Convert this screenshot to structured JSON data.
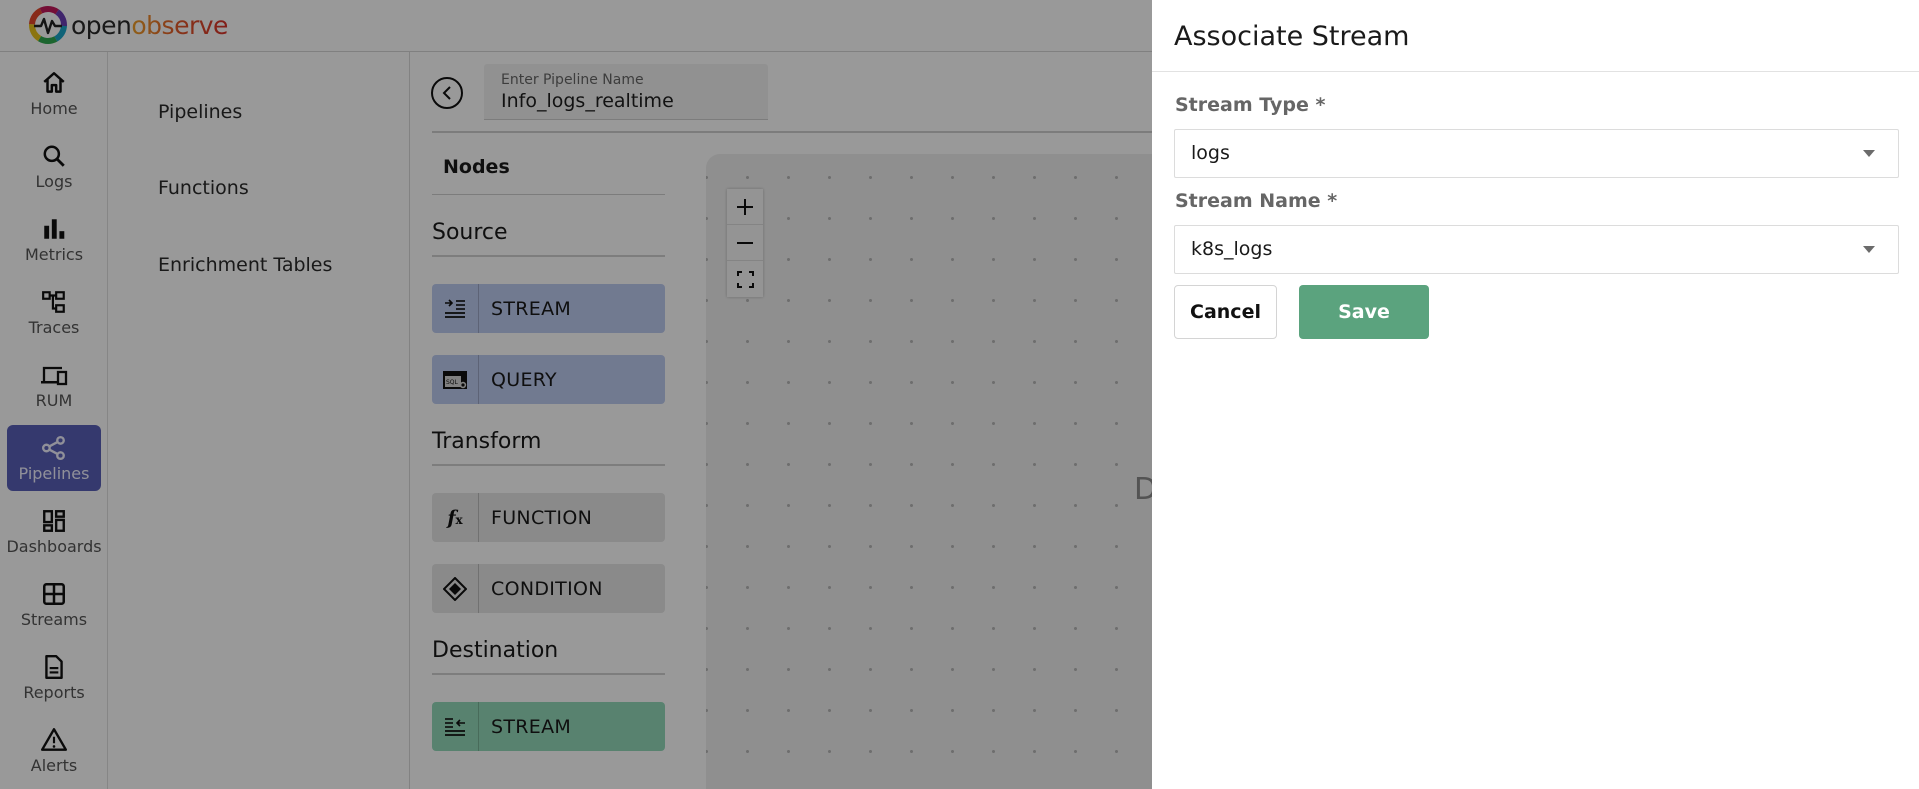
{
  "brand": {
    "name_part1": "open",
    "name_part2": "observe"
  },
  "leftnav": {
    "items": [
      {
        "label": "Home",
        "icon": "home-icon",
        "active": false
      },
      {
        "label": "Logs",
        "icon": "search-icon",
        "active": false
      },
      {
        "label": "Metrics",
        "icon": "bar-chart-icon",
        "active": false
      },
      {
        "label": "Traces",
        "icon": "traces-tree-icon",
        "active": false
      },
      {
        "label": "RUM",
        "icon": "devices-icon",
        "active": false
      },
      {
        "label": "Pipelines",
        "icon": "share-nodes-icon",
        "active": true
      },
      {
        "label": "Dashboards",
        "icon": "dashboard-icon",
        "active": false
      },
      {
        "label": "Streams",
        "icon": "grid-icon",
        "active": false
      },
      {
        "label": "Reports",
        "icon": "document-icon",
        "active": false
      },
      {
        "label": "Alerts",
        "icon": "warning-icon",
        "active": false
      }
    ]
  },
  "subnav": {
    "items": [
      {
        "label": "Pipelines"
      },
      {
        "label": "Functions"
      },
      {
        "label": "Enrichment Tables"
      }
    ]
  },
  "editor": {
    "pipeline_name_label": "Enter Pipeline Name",
    "pipeline_name_value": "Info_logs_realtime",
    "nodes_title": "Nodes",
    "sections": {
      "source": {
        "title": "Source",
        "nodes": [
          {
            "label": "STREAM",
            "icon": "stream-input-icon"
          },
          {
            "label": "QUERY",
            "icon": "sql-query-icon"
          }
        ]
      },
      "transform": {
        "title": "Transform",
        "nodes": [
          {
            "label": "FUNCTION",
            "icon": "function-fx-icon"
          },
          {
            "label": "CONDITION",
            "icon": "condition-diamond-icon"
          }
        ]
      },
      "destination": {
        "title": "Destination",
        "nodes": [
          {
            "label": "STREAM",
            "icon": "stream-output-icon"
          }
        ]
      }
    },
    "canvas_hint": "D",
    "zoom_controls": {
      "zoom_in": "+",
      "zoom_out": "−",
      "fit": "fit-view"
    }
  },
  "drawer": {
    "title": "Associate Stream",
    "stream_type": {
      "label": "Stream Type *",
      "value": "logs"
    },
    "stream_name": {
      "label": "Stream Name *",
      "value": "k8s_logs"
    },
    "cancel_label": "Cancel",
    "save_label": "Save"
  },
  "colors": {
    "nav_active": "#5960b8",
    "node_source": "#bdcbf1",
    "node_transform": "#e6e6e6",
    "node_destination": "#93d9b9",
    "save_button": "#5ba37e"
  }
}
